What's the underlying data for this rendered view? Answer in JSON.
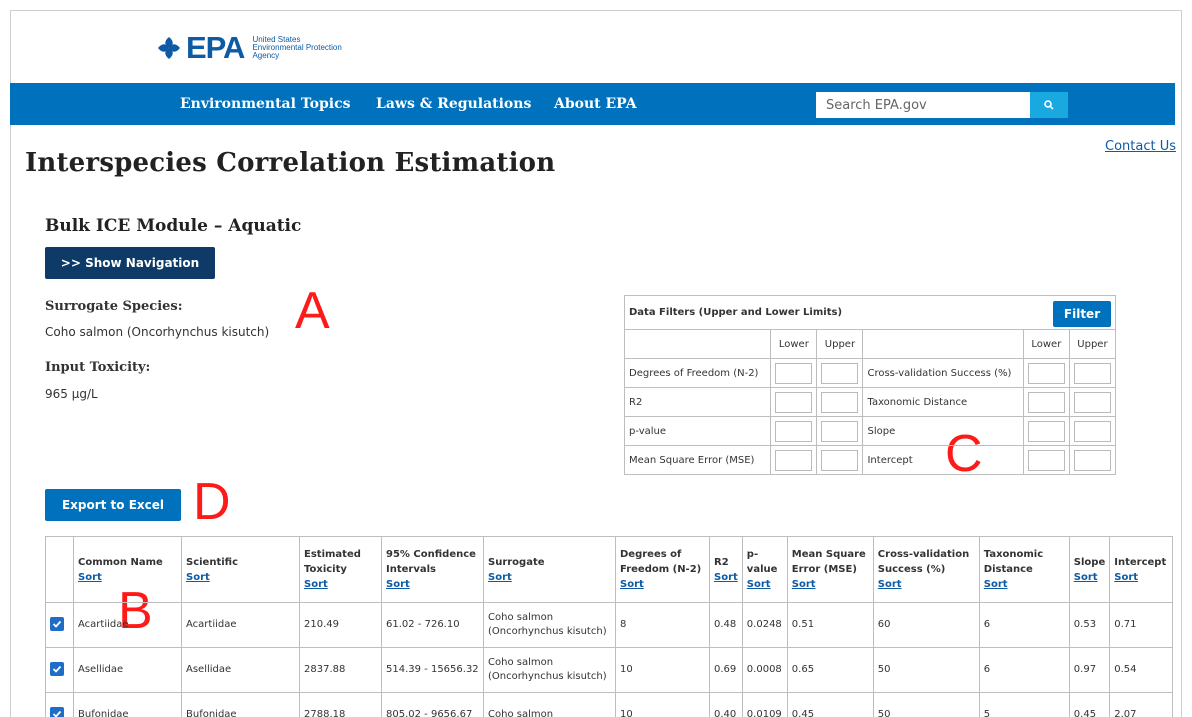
{
  "header": {
    "logo_word": "EPA",
    "logo_sub": [
      "United States",
      "Environmental Protection",
      "Agency"
    ]
  },
  "nav": {
    "items": [
      "Environmental Topics",
      "Laws & Regulations",
      "About EPA"
    ],
    "search_placeholder": "Search EPA.gov"
  },
  "contact_label": "Contact Us",
  "page_title": "Interspecies Correlation Estimation",
  "module_title": "Bulk ICE Module – Aquatic",
  "show_nav_label": ">> Show Navigation",
  "surrogate": {
    "label": "Surrogate Species:",
    "value": "Coho salmon (Oncorhynchus kisutch)"
  },
  "toxicity": {
    "label": "Input Toxicity:",
    "value": "965 µg/L"
  },
  "filters": {
    "title": "Data Filters (Upper and Lower Limits)",
    "button": "Filter",
    "lower": "Lower",
    "upper": "Upper",
    "left_rows": [
      "Degrees of Freedom (N-2)",
      "R2",
      "p-value",
      "Mean Square Error (MSE)"
    ],
    "right_rows": [
      "Cross-validation Success (%)",
      "Taxonomic Distance",
      "Slope",
      "Intercept"
    ]
  },
  "export_label": "Export to Excel",
  "annotations": {
    "a": "A",
    "b": "B",
    "c": "C",
    "d": "D"
  },
  "table": {
    "sort": "Sort",
    "columns": [
      "Common Name",
      "Scientific",
      "Estimated Toxicity",
      "95% Confidence Intervals",
      "Surrogate",
      "Degrees of Freedom (N-2)",
      "R2",
      "p-value",
      "Mean Square Error (MSE)",
      "Cross-validation Success (%)",
      "Taxonomic Distance",
      "Slope",
      "Intercept"
    ],
    "rows": [
      [
        "Acartiidae",
        "Acartiidae",
        "210.49",
        "61.02 - 726.10",
        "Coho salmon (Oncorhynchus kisutch)",
        "8",
        "0.48",
        "0.0248",
        "0.51",
        "60",
        "6",
        "0.53",
        "0.71"
      ],
      [
        "Asellidae",
        "Asellidae",
        "2837.88",
        "514.39 - 15656.32",
        "Coho salmon (Oncorhynchus kisutch)",
        "10",
        "0.69",
        "0.0008",
        "0.65",
        "50",
        "6",
        "0.97",
        "0.54"
      ],
      [
        "Bufonidae",
        "Bufonidae",
        "2788.18",
        "805.02 - 9656.67",
        "Coho salmon",
        "10",
        "0.40",
        "0.0109",
        "0.45",
        "50",
        "5",
        "0.45",
        "2.07"
      ]
    ]
  },
  "colors": {
    "nav_blue": "#0071bc",
    "dark_button": "#0d3a66",
    "annotation_red": "#ff1a1a",
    "search_button": "#1aa8e0"
  }
}
